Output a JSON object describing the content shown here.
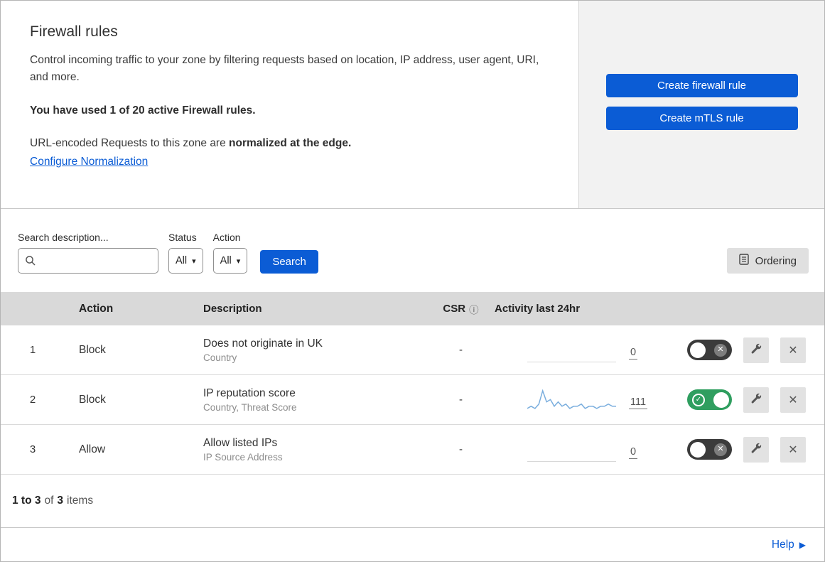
{
  "colors": {
    "accent": "#0b5cd5",
    "toggle_on": "#2f9e5f",
    "toggle_off": "#3b3b3b",
    "spark": "#7aaede",
    "table_header_bg": "#d9d9d9",
    "panel_bg": "#f2f2f2"
  },
  "icons": {
    "caret": "▾",
    "info": "ⓘ",
    "check": "✓",
    "cross": "✕",
    "close": "✕",
    "help_arrow": "▶"
  },
  "intro": {
    "title": "Firewall rules",
    "description": "Control incoming traffic to your zone by filtering requests based on location, IP address, user agent, URI, and more.",
    "usage": "You have used 1 of 20 active Firewall rules.",
    "normalization_prefix": "URL-encoded Requests to this zone are",
    "normalization_bold": "normalized at the edge.",
    "normalization_link": "Configure Normalization",
    "create_firewall_button": "Create firewall rule",
    "create_mtls_button": "Create mTLS rule"
  },
  "filters": {
    "search_label": "Search description...",
    "status_label": "Status",
    "status_value": "All",
    "action_label": "Action",
    "action_value": "All",
    "search_button": "Search",
    "ordering_button": "Ordering"
  },
  "table": {
    "headers": {
      "action": "Action",
      "description": "Description",
      "csr": "CSR",
      "activity": "Activity last 24hr"
    },
    "rows": [
      {
        "num": "1",
        "action": "Block",
        "description": "Does not originate in UK",
        "fields": "Country",
        "csr": "-",
        "activity": "0",
        "enabled": false,
        "sparkline": []
      },
      {
        "num": "2",
        "action": "Block",
        "description": "IP reputation score",
        "fields": "Country, Threat Score",
        "csr": "-",
        "activity": "111",
        "enabled": true,
        "sparkline": [
          1,
          2,
          1,
          3,
          9,
          4,
          5,
          2,
          4,
          2,
          3,
          1,
          2,
          2,
          3,
          1,
          2,
          2,
          1,
          2,
          2,
          3,
          2,
          2
        ]
      },
      {
        "num": "3",
        "action": "Allow",
        "description": "Allow listed IPs",
        "fields": "IP Source Address",
        "csr": "-",
        "activity": "0",
        "enabled": false,
        "sparkline": []
      }
    ]
  },
  "footer": {
    "range": "1 to 3",
    "of": "of",
    "total": "3",
    "items": "items"
  },
  "help": {
    "label": "Help"
  }
}
